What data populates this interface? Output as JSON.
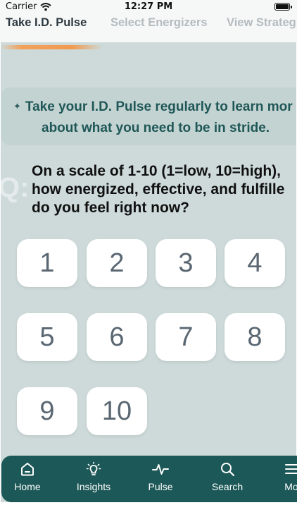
{
  "status_bar": {
    "carrier": "Carrier",
    "time": "12:27 PM"
  },
  "tabs": [
    {
      "label": "Take I.D. Pulse"
    },
    {
      "label": "Select Energizers"
    },
    {
      "label": "View Strateg"
    }
  ],
  "tip": {
    "line1": "Take your I.D. Pulse regularly to learn mor",
    "line2": "about what you need to be in stride."
  },
  "question": {
    "prefix": "Q:",
    "line1": "On a scale of 1-10 (1=low, 10=high),",
    "line2": "how energized, effective, and fulfille",
    "line3": "do you feel right now?"
  },
  "ratings": [
    "1",
    "2",
    "3",
    "4",
    "5",
    "6",
    "7",
    "8",
    "9",
    "10"
  ],
  "nav": [
    {
      "label": "Home",
      "icon": "home-icon"
    },
    {
      "label": "Insights",
      "icon": "lightbulb-icon"
    },
    {
      "label": "Pulse",
      "icon": "pulse-icon"
    },
    {
      "label": "Search",
      "icon": "search-icon"
    },
    {
      "label": "Mo",
      "icon": "menu-icon"
    }
  ],
  "colors": {
    "accent": "#1c5857",
    "background": "#cddad9",
    "tip_text": "#1f5757",
    "indicator": "#f19a50"
  }
}
